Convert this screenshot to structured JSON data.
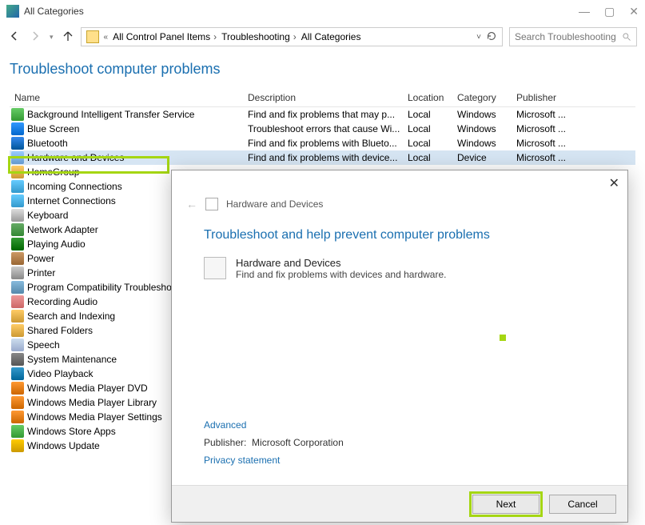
{
  "window": {
    "title": "All Categories",
    "breadcrumbs": [
      "All Control Panel Items",
      "Troubleshooting",
      "All Categories"
    ],
    "search_placeholder": "Search Troubleshooting"
  },
  "heading": "Troubleshoot computer problems",
  "columns": {
    "name": "Name",
    "description": "Description",
    "location": "Location",
    "category": "Category",
    "publisher": "Publisher"
  },
  "rows": [
    {
      "name": "Background Intelligent Transfer Service",
      "desc": "Find and fix problems that may p...",
      "loc": "Local",
      "cat": "Windows",
      "pub": "Microsoft ..."
    },
    {
      "name": "Blue Screen",
      "desc": "Troubleshoot errors that cause Wi...",
      "loc": "Local",
      "cat": "Windows",
      "pub": "Microsoft ..."
    },
    {
      "name": "Bluetooth",
      "desc": "Find and fix problems with Blueto...",
      "loc": "Local",
      "cat": "Windows",
      "pub": "Microsoft ..."
    },
    {
      "name": "Hardware and Devices",
      "desc": "Find and fix problems with device...",
      "loc": "Local",
      "cat": "Device",
      "pub": "Microsoft ...",
      "selected": true
    },
    {
      "name": "HomeGroup",
      "desc": "",
      "loc": "",
      "cat": "",
      "pub": ""
    },
    {
      "name": "Incoming Connections",
      "desc": "",
      "loc": "",
      "cat": "",
      "pub": ""
    },
    {
      "name": "Internet Connections",
      "desc": "",
      "loc": "",
      "cat": "",
      "pub": ""
    },
    {
      "name": "Keyboard",
      "desc": "",
      "loc": "",
      "cat": "",
      "pub": ""
    },
    {
      "name": "Network Adapter",
      "desc": "",
      "loc": "",
      "cat": "",
      "pub": ""
    },
    {
      "name": "Playing Audio",
      "desc": "",
      "loc": "",
      "cat": "",
      "pub": ""
    },
    {
      "name": "Power",
      "desc": "",
      "loc": "",
      "cat": "",
      "pub": ""
    },
    {
      "name": "Printer",
      "desc": "",
      "loc": "",
      "cat": "",
      "pub": ""
    },
    {
      "name": "Program Compatibility Troubleshooter",
      "desc": "",
      "loc": "",
      "cat": "",
      "pub": ""
    },
    {
      "name": "Recording Audio",
      "desc": "",
      "loc": "",
      "cat": "",
      "pub": ""
    },
    {
      "name": "Search and Indexing",
      "desc": "",
      "loc": "",
      "cat": "",
      "pub": ""
    },
    {
      "name": "Shared Folders",
      "desc": "",
      "loc": "",
      "cat": "",
      "pub": ""
    },
    {
      "name": "Speech",
      "desc": "",
      "loc": "",
      "cat": "",
      "pub": ""
    },
    {
      "name": "System Maintenance",
      "desc": "",
      "loc": "",
      "cat": "",
      "pub": ""
    },
    {
      "name": "Video Playback",
      "desc": "",
      "loc": "",
      "cat": "",
      "pub": ""
    },
    {
      "name": "Windows Media Player DVD",
      "desc": "",
      "loc": "",
      "cat": "",
      "pub": ""
    },
    {
      "name": "Windows Media Player Library",
      "desc": "",
      "loc": "",
      "cat": "",
      "pub": ""
    },
    {
      "name": "Windows Media Player Settings",
      "desc": "",
      "loc": "",
      "cat": "",
      "pub": ""
    },
    {
      "name": "Windows Store Apps",
      "desc": "",
      "loc": "",
      "cat": "",
      "pub": ""
    },
    {
      "name": "Windows Update",
      "desc": "",
      "loc": "",
      "cat": "",
      "pub": ""
    }
  ],
  "dialog": {
    "breadcrumb": "Hardware and Devices",
    "title": "Troubleshoot and help prevent computer problems",
    "item_title": "Hardware and Devices",
    "item_desc": "Find and fix problems with devices and hardware.",
    "advanced": "Advanced",
    "publisher_label": "Publisher:",
    "publisher_value": "Microsoft Corporation",
    "privacy": "Privacy statement",
    "next": "Next",
    "cancel": "Cancel"
  }
}
